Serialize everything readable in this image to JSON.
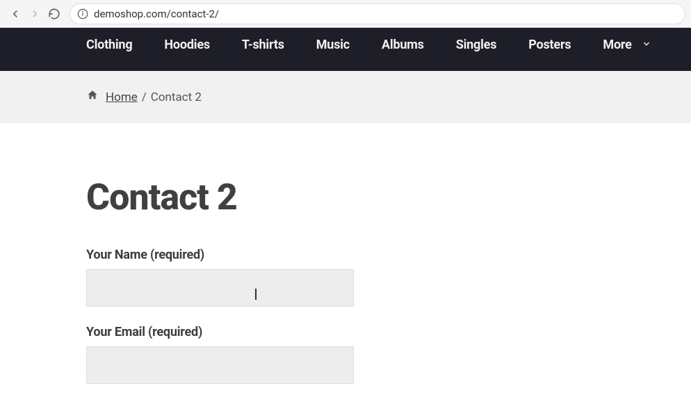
{
  "browser": {
    "url": "demoshop.com/contact-2/"
  },
  "nav": {
    "items": [
      "Clothing",
      "Hoodies",
      "T-shirts",
      "Music",
      "Albums",
      "Singles",
      "Posters"
    ],
    "more_label": "More"
  },
  "breadcrumb": {
    "home_label": "Home",
    "separator": "/",
    "current": "Contact 2"
  },
  "page": {
    "title": "Contact 2"
  },
  "form": {
    "name_label": "Your Name (required)",
    "name_value": "",
    "email_label": "Your Email (required)",
    "email_value": ""
  }
}
